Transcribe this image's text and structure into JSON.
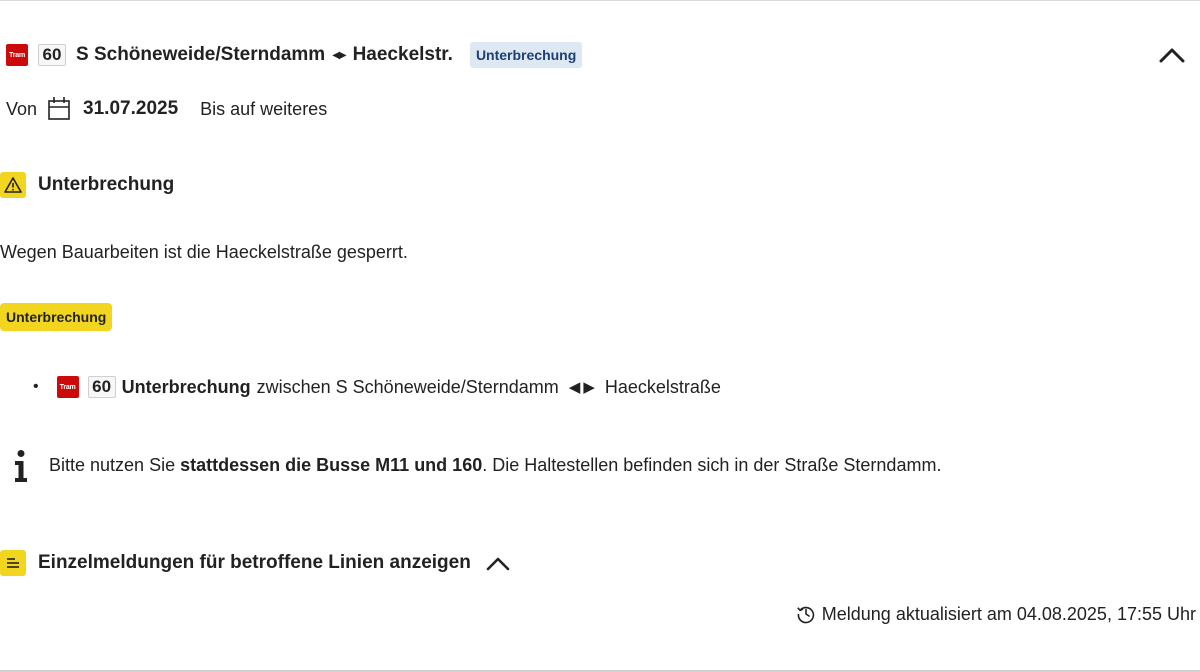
{
  "header": {
    "mode_label": "Tram",
    "line_number": "60",
    "route_from": "S Schöneweide/Sterndamm",
    "route_arrows": "◀▶",
    "route_to": "Haeckelstr.",
    "status_tag": "Unterbrechung",
    "collapse_icon": "chevron-up-icon"
  },
  "validity": {
    "von_label": "Von",
    "calendar_icon": "calendar-icon",
    "start_date": "31.07.2025",
    "end_label": "Bis auf weiteres"
  },
  "section": {
    "warning_icon": "warning-icon",
    "title": "Unterbrechung",
    "description": "Wegen Bauarbeiten ist die Haeckelstraße gesperrt."
  },
  "impact": {
    "tag": "Unterbrechung",
    "items": [
      {
        "bullet": "•",
        "mode_label": "Tram",
        "line_number": "60",
        "type": "Unterbrechung",
        "between": "zwischen S Schöneweide/Sterndamm",
        "arrow_left": "◀",
        "arrow_right": "▶",
        "to": "Haeckelstraße"
      }
    ]
  },
  "info": {
    "icon": "info-icon",
    "text_before": "Bitte nutzen Sie",
    "text_bold": "stattdessen die Busse M11 und 160",
    "text_after": ". Die Haltestellen befinden sich in der Straße Sterndamm."
  },
  "details_toggle": {
    "icon": "list-icon",
    "label": "Einzelmeldungen für betroffene Linien anzeigen",
    "chevron_icon": "chevron-up-icon"
  },
  "footer": {
    "history_icon": "history-icon",
    "updated_text": "Meldung aktualisiert am 04.08.2025, 17:55 Uhr"
  },
  "colors": {
    "tram_red": "#cc0a0a",
    "yellow": "#f2d51e",
    "blue_tag_bg": "#dde8f3",
    "blue_tag_text": "#1d3f73",
    "text": "#222222"
  }
}
